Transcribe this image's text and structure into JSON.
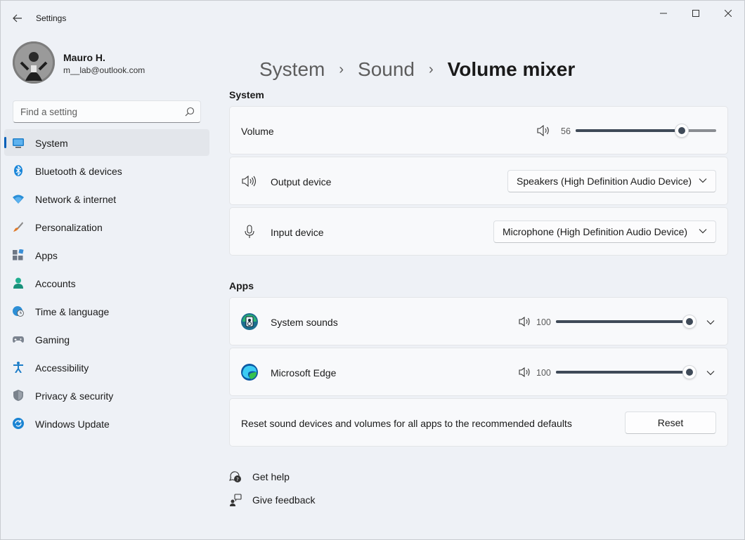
{
  "window": {
    "title": "Settings"
  },
  "user": {
    "name": "Mauro H.",
    "email": "m__lab@outlook.com"
  },
  "search": {
    "placeholder": "Find a setting"
  },
  "nav": [
    {
      "label": "System",
      "icon": "system-icon",
      "active": true
    },
    {
      "label": "Bluetooth & devices",
      "icon": "bluetooth-icon"
    },
    {
      "label": "Network & internet",
      "icon": "wifi-icon"
    },
    {
      "label": "Personalization",
      "icon": "brush-icon"
    },
    {
      "label": "Apps",
      "icon": "apps-icon"
    },
    {
      "label": "Accounts",
      "icon": "person-icon"
    },
    {
      "label": "Time & language",
      "icon": "globe-clock-icon"
    },
    {
      "label": "Gaming",
      "icon": "controller-icon"
    },
    {
      "label": "Accessibility",
      "icon": "accessibility-icon"
    },
    {
      "label": "Privacy & security",
      "icon": "shield-icon"
    },
    {
      "label": "Windows Update",
      "icon": "update-icon"
    }
  ],
  "breadcrumb": {
    "items": [
      "System",
      "Sound"
    ],
    "current": "Volume mixer"
  },
  "system_section": {
    "title": "System",
    "volume": {
      "label": "Volume",
      "value": "56",
      "level": 0.56
    },
    "output": {
      "label": "Output device",
      "selected": "Speakers (High Definition Audio Device)"
    },
    "input": {
      "label": "Input device",
      "selected": "Microphone (High Definition Audio Device)"
    }
  },
  "apps_section": {
    "title": "Apps",
    "apps": [
      {
        "name": "System sounds",
        "value": "100",
        "level": 1.0,
        "icon": "system-sounds-icon"
      },
      {
        "name": "Microsoft Edge",
        "value": "100",
        "level": 1.0,
        "icon": "edge-icon"
      }
    ],
    "reset": {
      "text": "Reset sound devices and volumes for all apps to the recommended defaults",
      "button": "Reset"
    }
  },
  "footer": {
    "help": "Get help",
    "feedback": "Give feedback"
  },
  "colors": {
    "accent": "#005fb8",
    "slider": "#3f4a58"
  }
}
